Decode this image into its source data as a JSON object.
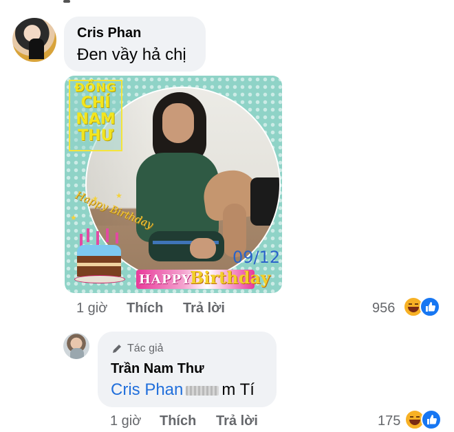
{
  "comment1": {
    "author": "Cris Phan",
    "text": "Đen vầy hả chị",
    "time": "1 giờ",
    "like_label": "Thích",
    "reply_label": "Trả lời",
    "reaction_count": "956",
    "image": {
      "title_lines": [
        "ĐỒNG",
        "CHÍ",
        "NAM",
        "THƯ"
      ],
      "date": "09/12",
      "happy_birthday_arc": "Happy Birthday",
      "banner_happy": "HAPPY",
      "banner_birthday": "Birthday"
    }
  },
  "reply1": {
    "author_badge": "Tác giả",
    "author": "Trần Nam Thư",
    "mention": "Cris Phan",
    "text_after": "m Tí",
    "time": "1 giờ",
    "like_label": "Thích",
    "reply_label": "Trả lời",
    "reaction_count": "175"
  },
  "colors": {
    "bubble": "#f0f2f5",
    "meta_gray": "#65676b",
    "mention_blue": "#216fdb",
    "like_blue": "#1877f2",
    "haha_yellow": "#f7b125",
    "card_teal": "#8fd3c7"
  }
}
